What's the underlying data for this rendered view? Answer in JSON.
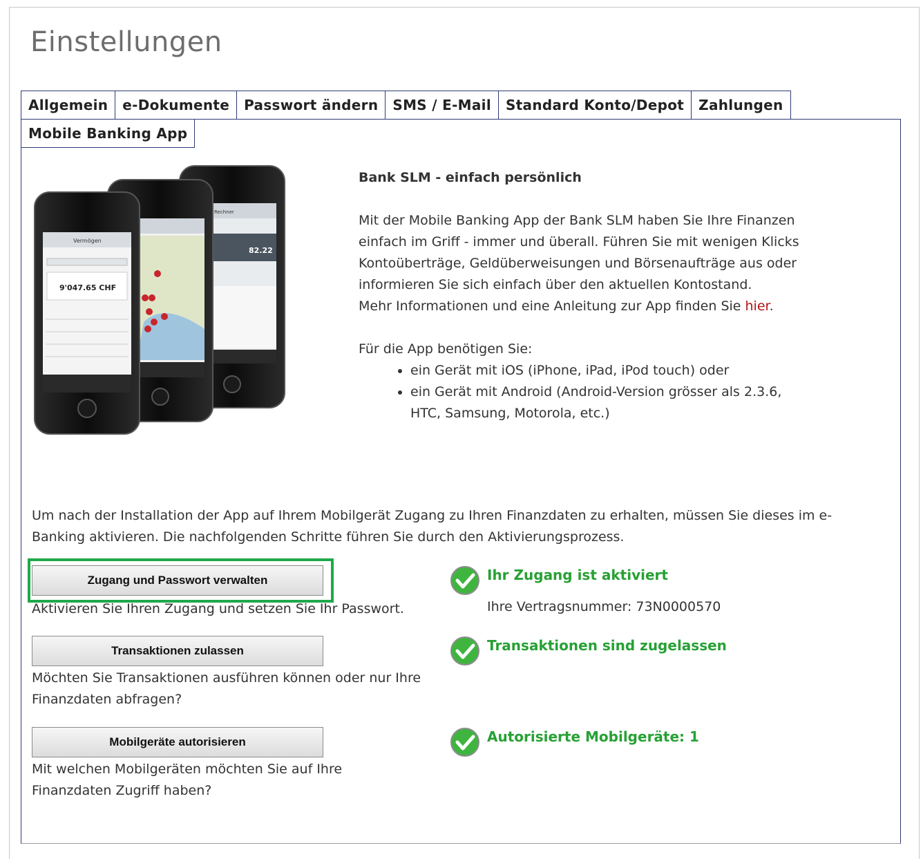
{
  "page_title": "Einstellungen",
  "tabs_row1": [
    "Allgemein",
    "e-Dokumente",
    "Passwort ändern",
    "SMS / E-Mail",
    "Standard Konto/Depot",
    "Zahlungen"
  ],
  "active_tab": "Mobile Banking App",
  "phones_image": {
    "screen1_title": "Vermögen",
    "screen1_amount": "9'047.65 CHF",
    "screen3_title": "Rechner",
    "screen3_value": "82.22"
  },
  "info": {
    "heading": "Bank SLM - einfach persönlich",
    "paragraph": "Mit der Mobile Banking App der Bank SLM haben Sie Ihre Finanzen einfach im Griff - immer und überall. Führen Sie mit wenigen Klicks Kontoüberträge, Geldüberweisungen und Börsenaufträge aus oder informieren Sie sich einfach über den aktuellen Kontostand.",
    "more_info": "Mehr Informationen und eine Anleitung zur App finden Sie",
    "link_text": "hier",
    "link_suffix": ".",
    "req_heading": "Für die App benötigen Sie:",
    "requirements": [
      "ein Gerät mit iOS (iPhone, iPad, iPod touch) oder",
      "ein Gerät mit Android (Android-Version grösser als 2.3.6, HTC, Samsung, Motorola, etc.)"
    ]
  },
  "intro": "Um nach der Installation der App auf Ihrem Mobilgerät Zugang zu Ihren Finanzdaten zu erhalten, müssen Sie dieses im e-Banking aktivieren. Die nachfolgenden Schritte führen Sie durch den Aktivierungsprozess.",
  "steps": [
    {
      "button": "Zugang und Passwort verwalten",
      "description": "Aktivieren Sie Ihren Zugang und setzen Sie Ihr Passwort.",
      "status": "Ihr Zugang ist aktiviert",
      "detail": "Ihre Vertragsnummer: 73N0000570"
    },
    {
      "button": "Transaktionen zulassen",
      "description": "Möchten Sie Transaktionen ausführen können oder nur Ihre Finanzdaten abfragen?",
      "status": "Transaktionen sind zugelassen"
    },
    {
      "button": "Mobilgeräte autorisieren",
      "description": "Mit welchen Mobilgeräten möchten Sie auf Ihre Finanzdaten Zugriff haben?",
      "status": "Autorisierte Mobilgeräte: 1"
    }
  ],
  "colors": {
    "tab_border": "#2e3a73",
    "status_green": "#27a134",
    "highlight_green": "#1fa84a",
    "link_red": "#b31414"
  }
}
